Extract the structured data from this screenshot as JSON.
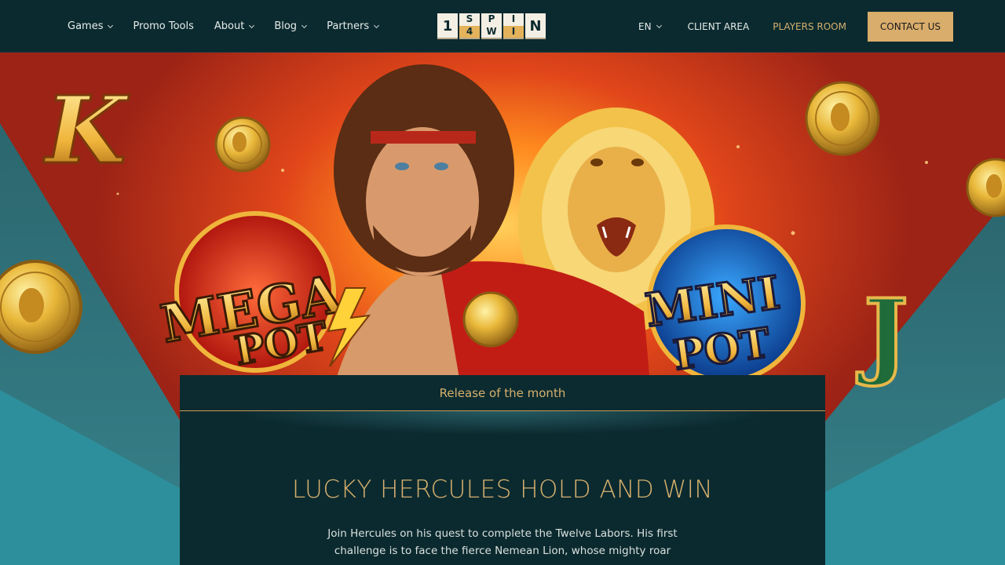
{
  "header": {
    "nav_left": [
      {
        "label": "Games",
        "has_dropdown": true
      },
      {
        "label": "Promo Tools",
        "has_dropdown": false
      },
      {
        "label": "About",
        "has_dropdown": true
      },
      {
        "label": "Blog",
        "has_dropdown": true
      },
      {
        "label": "Partners",
        "has_dropdown": true
      }
    ],
    "logo": {
      "tiles": [
        "1",
        "S",
        "4",
        "P",
        "W",
        "I",
        "I",
        "N"
      ]
    },
    "language": "EN",
    "client_area": "CLIENT AREA",
    "players_room": "PLAYERS ROOM",
    "contact": "CONTACT US"
  },
  "hero": {
    "mega_pot_line1": "MEGA",
    "mega_pot_line2": "POT",
    "mini_pot_line1": "MINI",
    "mini_pot_line2": "POT",
    "symbol_left": "K",
    "symbol_right": "J"
  },
  "release": {
    "heading": "Release of the month",
    "title": "LUCKY HERCULES HOLD AND WIN",
    "description": "Join Hercules on his quest to complete the Twelve Labors. His first challenge is to face the fierce Nemean Lion, whose mighty roar"
  },
  "colors": {
    "header_bg": "#0b2a2f",
    "accent_gold": "#d9ad6c",
    "panel_bg": "#0b2a2f"
  }
}
